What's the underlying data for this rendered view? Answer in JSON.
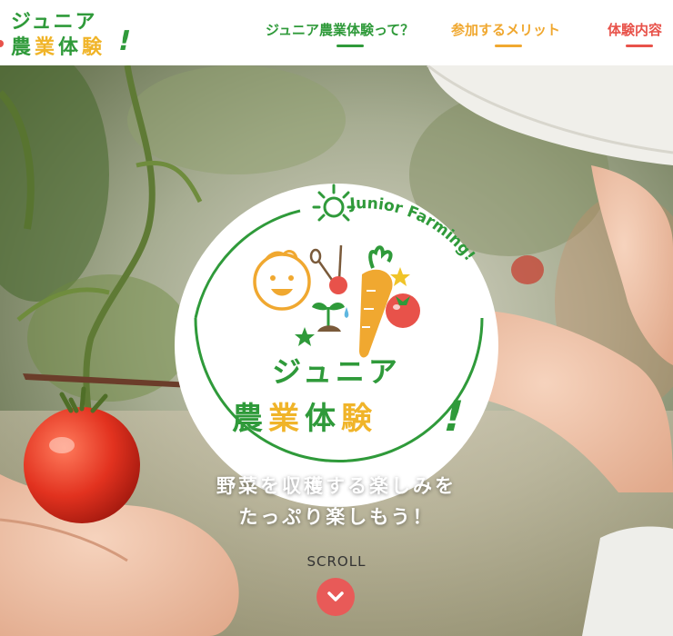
{
  "header": {
    "logo": {
      "line1": "ジュニア",
      "line2_chars": [
        "農",
        "業",
        "体",
        "験"
      ],
      "exclaim": "!"
    },
    "nav": [
      {
        "label": "ジュニア農業体験って？",
        "color": "#2f9a3a"
      },
      {
        "label": "参加するメリット",
        "color": "#f0a830"
      },
      {
        "label": "体験内容",
        "color": "#e8524a"
      }
    ]
  },
  "badge": {
    "arc_text": "Junior Farming!",
    "title_line1": "ジュニア",
    "title_line2_chars": [
      "農",
      "業",
      "体",
      "験"
    ],
    "exclaim": "!"
  },
  "hero": {
    "tagline_line1": "野菜を収穫する楽しみを",
    "tagline_line2": "たっぷり楽しもう！"
  },
  "scroll": {
    "label": "SCROLL",
    "icon": "chevron-down-icon"
  },
  "colors": {
    "green": "#2f9a3a",
    "yellow": "#f0b429",
    "orange": "#f0a830",
    "red": "#e8524a"
  }
}
